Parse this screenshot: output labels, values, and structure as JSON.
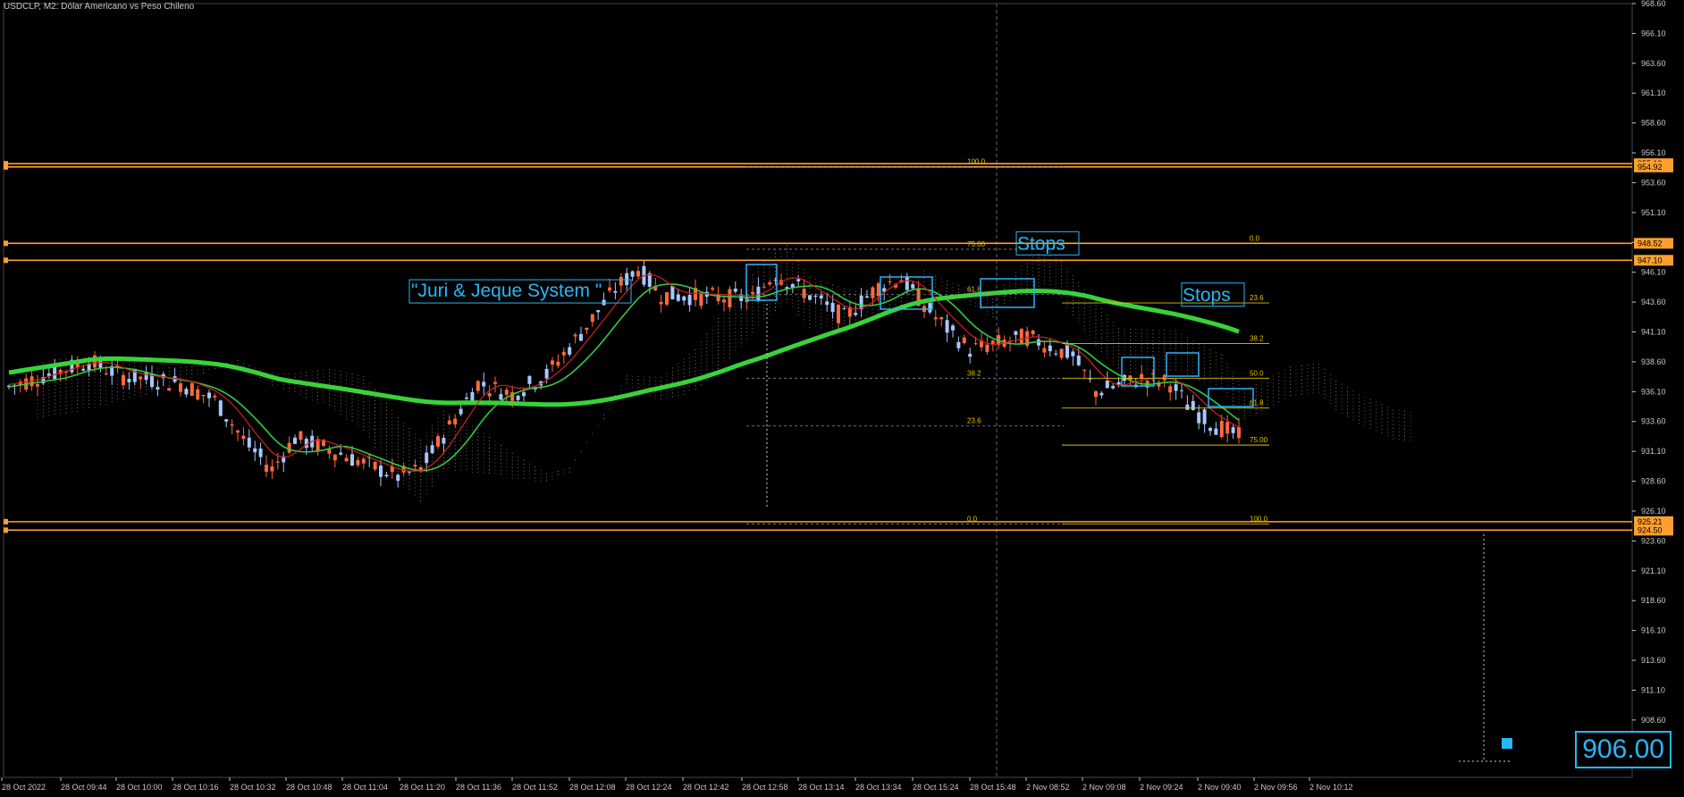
{
  "window": {
    "title": "USDCLP, M2:  Dólar Americano vs Peso Chileno"
  },
  "chart_data": {
    "type": "candlestick",
    "symbol": "USDCLP",
    "timeframe": "M2",
    "description": "Dólar Americano vs Peso Chileno",
    "ylim": [
      903.8,
      968.6
    ],
    "y_ticks": [
      "968.60",
      "966.10",
      "963.60",
      "961.10",
      "958.60",
      "956.10",
      "953.60",
      "951.10",
      "948.60",
      "946.10",
      "943.60",
      "941.10",
      "938.60",
      "936.10",
      "933.60",
      "931.10",
      "928.60",
      "926.10",
      "923.60",
      "921.10",
      "918.60",
      "916.10",
      "913.60",
      "911.10",
      "908.60",
      "906.10"
    ],
    "x_ticks": [
      "28 Oct 2022",
      "28 Oct 09:44",
      "28 Oct 10:00",
      "28 Oct 10:16",
      "28 Oct 10:32",
      "28 Oct 10:48",
      "28 Oct 11:04",
      "28 Oct 11:20",
      "28 Oct 11:36",
      "28 Oct 11:52",
      "28 Oct 12:08",
      "28 Oct 12:24",
      "28 Oct 12:42",
      "28 Oct 12:58",
      "28 Oct 13:14",
      "28 Oct 13:34",
      "28 Oct 15:24",
      "28 Oct 15:48",
      "2 Nov 08:52",
      "2 Nov 09:08",
      "2 Nov 09:24",
      "2 Nov 09:40",
      "2 Nov 09:56",
      "2 Nov 10:12"
    ],
    "horizontal_levels": [
      {
        "price": 955.19,
        "label": "955.19"
      },
      {
        "price": 954.92,
        "label": "954.92"
      },
      {
        "price": 948.52,
        "label": "948.52"
      },
      {
        "price": 947.1,
        "label": "947.10"
      },
      {
        "price": 925.21,
        "label": "925.21"
      },
      {
        "price": 924.5,
        "label": "924.50"
      }
    ],
    "annotations": [
      {
        "text": "\"Juri & Jeque System \"",
        "price": 944.2,
        "bar": 70
      },
      {
        "text": "Stops",
        "price": 948.3,
        "bar": 175
      },
      {
        "text": "Stops",
        "price": 944.0,
        "bar": 203
      },
      {
        "text": "906.00",
        "kind": "price-label"
      }
    ],
    "fib_labels_1": [
      {
        "text": "100.0",
        "price": 955.3
      },
      {
        "text": "75.00",
        "price": 948.4
      },
      {
        "text": "61.8",
        "price": 944.6
      },
      {
        "text": "38.2",
        "price": 937.6
      },
      {
        "text": "23.6",
        "price": 933.6
      },
      {
        "text": "0.0",
        "price": 925.4
      }
    ],
    "fib_labels_2": [
      {
        "text": "0.0",
        "price": 948.9
      },
      {
        "text": "23.6",
        "price": 943.9
      },
      {
        "text": "38.2",
        "price": 940.5
      },
      {
        "text": "50.0",
        "price": 937.6
      },
      {
        "text": "61.8",
        "price": 935.1
      },
      {
        "text": "75.00",
        "price": 932.0
      },
      {
        "text": "100.0",
        "price": 925.4
      }
    ],
    "series": [
      {
        "name": "ma-slow",
        "color": "#39d339"
      },
      {
        "name": "ma-fast-green",
        "color": "#2ecc40"
      },
      {
        "name": "ma-fast-red",
        "color": "#d21f1f"
      }
    ],
    "colors": {
      "bull": "#a6c8ff",
      "bear": "#ff6a3d",
      "level": "#ff9f2e",
      "accent": "#29b6f6",
      "fib": "#e6c200",
      "axis_text": "#c8c8c8",
      "grid_border": "#3a4a5a"
    }
  }
}
